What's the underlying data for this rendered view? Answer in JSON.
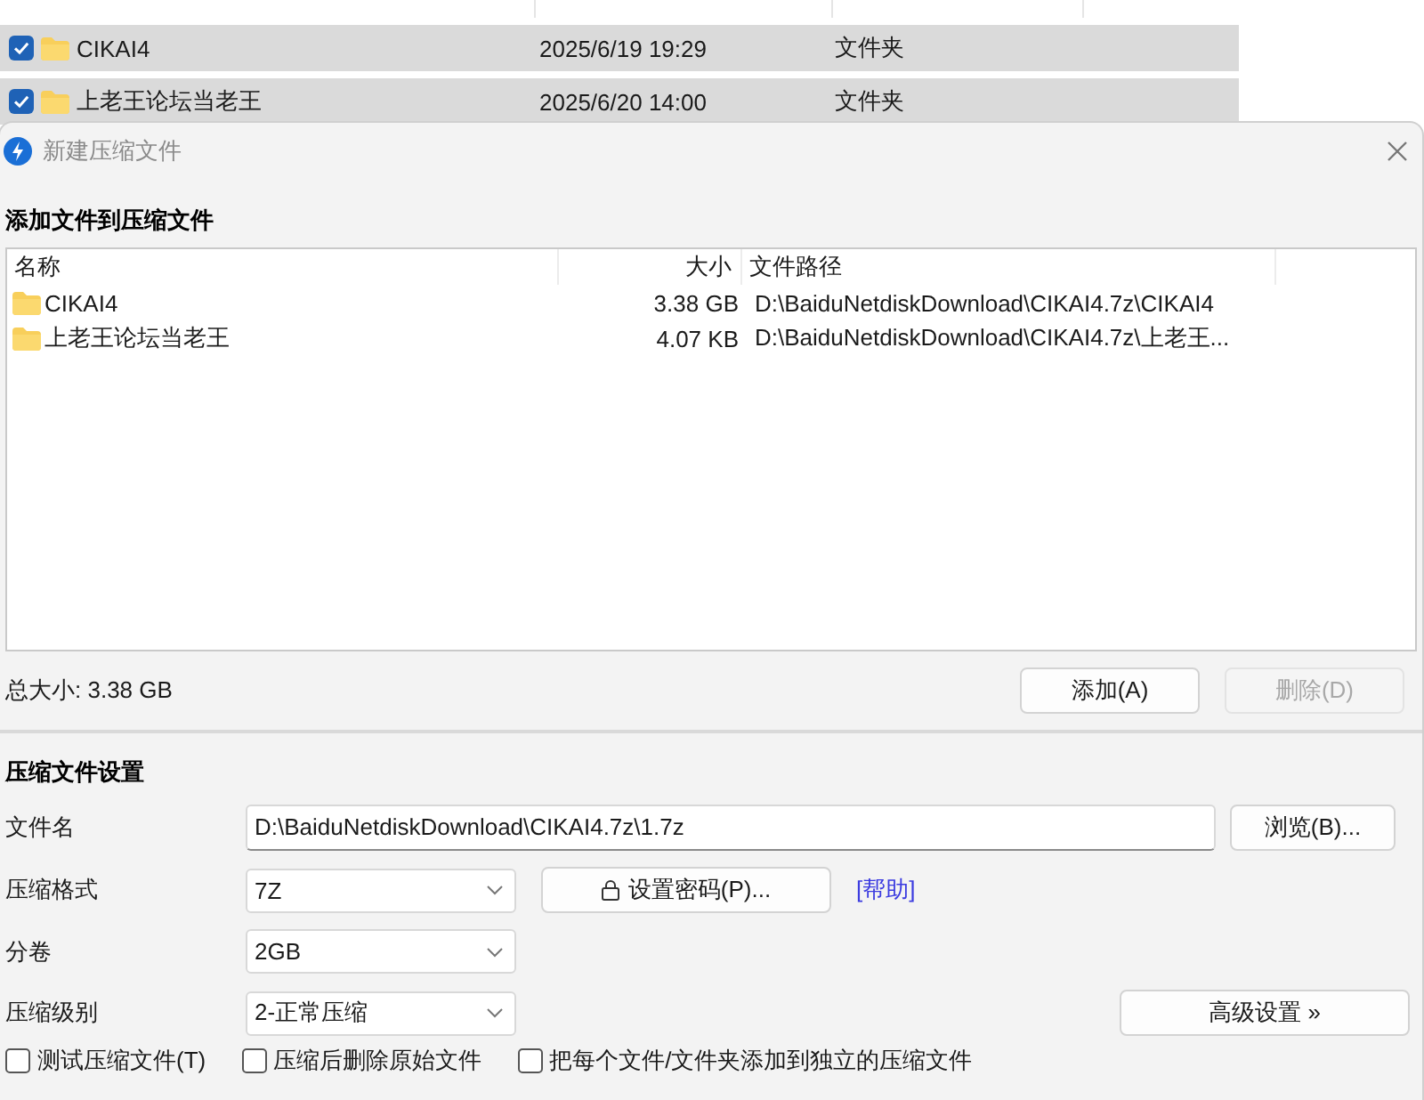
{
  "explorer_rows": [
    {
      "name": "CIKAI4",
      "modified": "2025/6/19 19:29",
      "type": "文件夹",
      "checked": true
    },
    {
      "name": "上老王论坛当老王",
      "modified": "2025/6/20 14:00",
      "type": "文件夹",
      "checked": true
    }
  ],
  "dialog": {
    "title": "新建压缩文件",
    "add_heading": "添加文件到压缩文件",
    "file_list": {
      "columns": [
        "名称",
        "大小",
        "文件路径"
      ],
      "rows": [
        {
          "name": "CIKAI4",
          "size": "3.38 GB",
          "path": "D:\\BaiduNetdiskDownload\\CIKAI4.7z\\CIKAI4"
        },
        {
          "name": "上老王论坛当老王",
          "size": "4.07 KB",
          "path": "D:\\BaiduNetdiskDownload\\CIKAI4.7z\\上老王..."
        }
      ]
    },
    "total_size": "总大小: 3.38 GB",
    "list_buttons": [
      {
        "label": "添加(A)",
        "disabled": false
      },
      {
        "label": "删除(D)",
        "disabled": true
      }
    ],
    "settings_heading": "压缩文件设置",
    "filename": {
      "label": "文件名",
      "value": "D:\\BaiduNetdiskDownload\\CIKAI4.7z\\1.7z"
    },
    "browse_button": "浏览(B)...",
    "format": {
      "label": "压缩格式",
      "value": "7Z"
    },
    "password_button": "设置密码(P)...",
    "help_link": "[帮助]",
    "volume": {
      "label": "分卷",
      "value": "2GB"
    },
    "level": {
      "label": "压缩级别",
      "value": "2-正常压缩"
    },
    "advanced_button": "高级设置 »",
    "options": [
      {
        "label": "测试压缩文件(T)",
        "checked": false
      },
      {
        "label": "压缩后删除原始文件",
        "checked": false
      },
      {
        "label": "把每个文件/文件夹添加到独立的压缩文件",
        "checked": false
      }
    ]
  }
}
